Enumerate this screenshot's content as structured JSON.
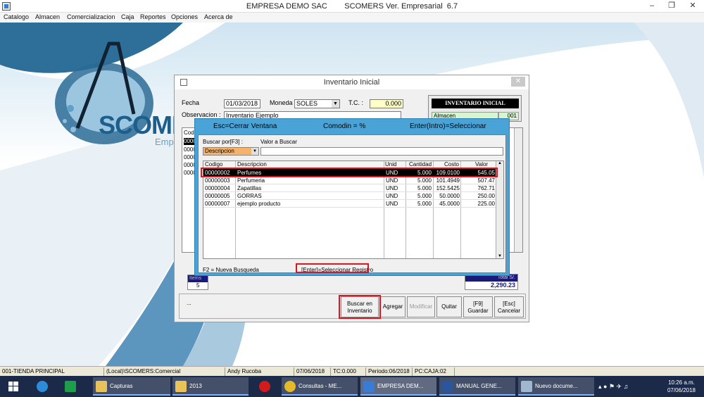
{
  "window": {
    "title": "EMPRESA DEMO SAC        SCOMERS Ver. Empresarial  6.7"
  },
  "menu": [
    "Catalogo",
    "Almacen",
    "Comercializacion",
    "Caja",
    "Reportes",
    "Opciones",
    "Acerca de"
  ],
  "logo": {
    "text": "SCOMERS",
    "subtext": "Empres"
  },
  "inventory": {
    "title": "Inventario Inicial",
    "fecha_label": "Fecha",
    "fecha_value": "01/03/2018",
    "moneda_label": "Moneda :",
    "moneda_value": "SOLES",
    "tc_label": "T.C. :",
    "tc_value": "0.000",
    "obs_label": "Observacion :",
    "obs_value": "Inventario Ejemplo",
    "badge_title": "INVENTARIO INICIAL",
    "almacen_label": "Almacen",
    "almacen_code": "001",
    "left_col_header": "Cod",
    "left_codes": [
      "0000",
      "0000",
      "0000",
      "0000",
      "0000"
    ],
    "items_label": "Items",
    "items_value": "5",
    "total_label": "Total S/.",
    "total_value": "2,290.23",
    "dots": "..."
  },
  "buttons": {
    "buscar": "Buscar en Inventario",
    "agregar": "Agregar",
    "modificar": "Modificar",
    "quitar": "Quitar",
    "guardar_key": "[F9]",
    "guardar": "Guardar",
    "cancelar_key": "[Esc]",
    "cancelar": "Cancelar"
  },
  "search": {
    "esc_hint": "Esc=Cerrar Ventana",
    "comodin_hint": "Comodin = %",
    "enter_hint": "Enter(Intro)=Seleccionar",
    "buscar_por_label": "Buscar por[F3] :",
    "valor_label": "Valor a Buscar",
    "criterio": "Descripcion",
    "columns": [
      "Codigo",
      "Descripcion",
      "Unid",
      "Cantidad",
      "Costo",
      "Valor"
    ],
    "rows": [
      [
        "00000002",
        "Perfumes",
        "UND",
        "5.000",
        "109.0100",
        "545.05"
      ],
      [
        "00000003",
        "Perfumeria",
        "UND",
        "5.000",
        "101.4949",
        "507.47"
      ],
      [
        "00000004",
        "Zapatillas",
        "UND",
        "5.000",
        "152.5425",
        "762.71"
      ],
      [
        "00000005",
        "GORRAS",
        "UND",
        "5.000",
        "50.0000",
        "250.00"
      ],
      [
        "00000007",
        "ejemplo producto",
        "UND",
        "5.000",
        "45.0000",
        "225.00"
      ]
    ],
    "f2_hint": "F2 = Nueva Busqueda",
    "enter_select": "[Enter]=Seleccionar Registro"
  },
  "status": {
    "tienda": "001-TIENDA PRINCIPAL",
    "ruta": "(Local)\\SCOMERS:Comercial",
    "usuario": "Andy Rucoba",
    "fecha": "07/06/2018",
    "tc": "TC:0.000",
    "periodo": "Periodo:06/2018",
    "pc": "PC:CAJA:02"
  },
  "taskbar": {
    "items": [
      "Capturas",
      "2013",
      "Consultas - ME...",
      "EMPRESA DEM...",
      "MANUAL GENE...",
      "Nuevo docume..."
    ],
    "time": "10:26 a.m.",
    "date": "07/06/2018"
  }
}
